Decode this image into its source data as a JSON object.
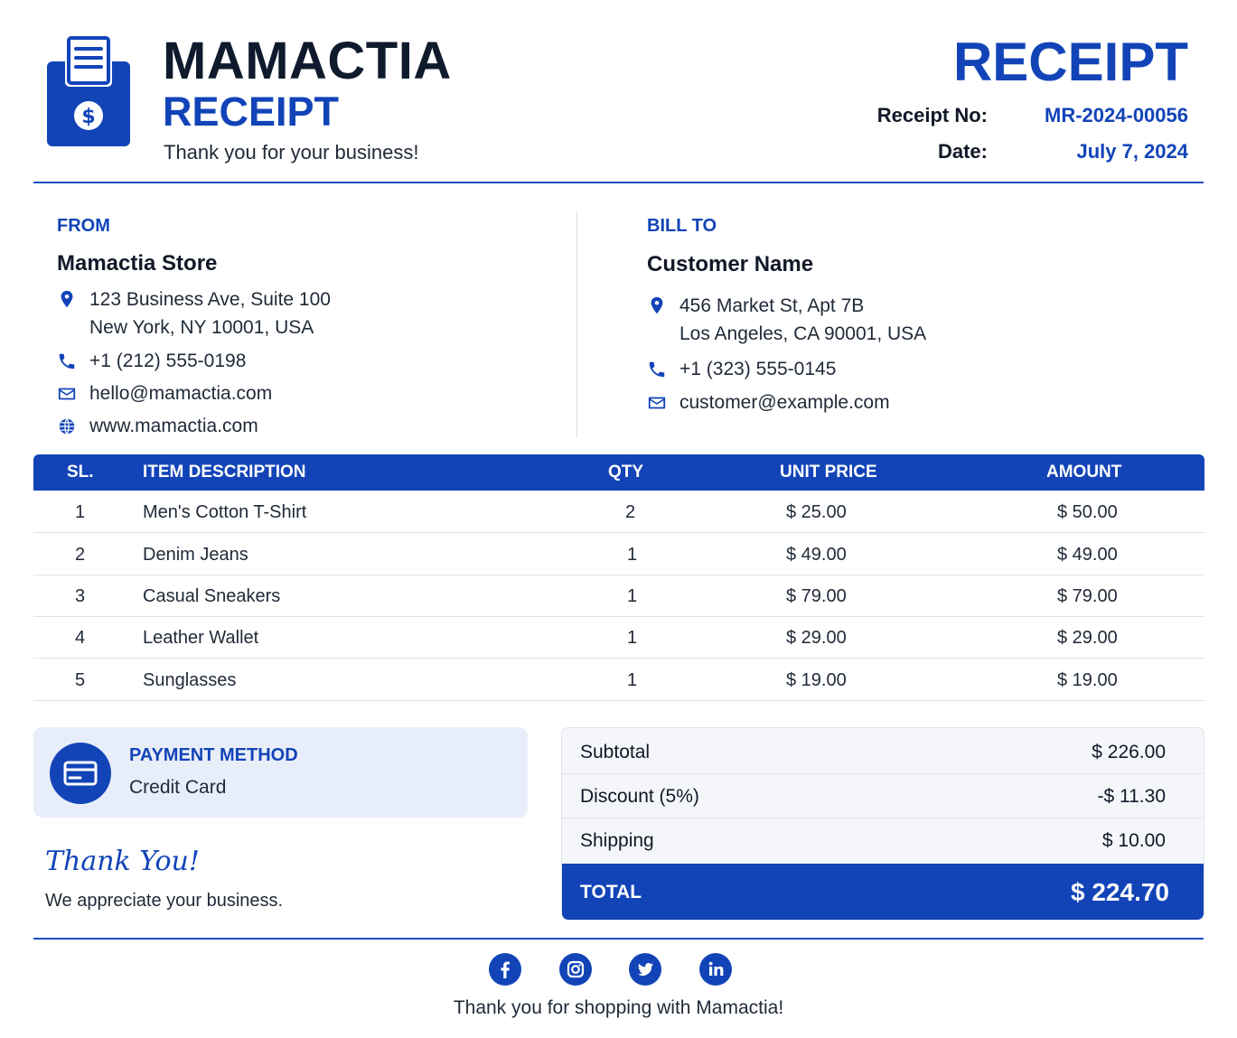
{
  "header": {
    "brand": "MAMACTIA",
    "subtitle": "RECEIPT",
    "tagline": "Thank you for your business!",
    "doc_title": "RECEIPT",
    "receipt_no_label": "Receipt No:",
    "receipt_no": "MR-2024-00056",
    "date_label": "Date:",
    "date": "July 7, 2024",
    "logo_icon": "receipt-dollar-icon"
  },
  "from": {
    "heading": "FROM",
    "name": "Mamactia Store",
    "address_line1": "123 Business Ave, Suite 100",
    "address_line2": "New York, NY 10001, USA",
    "phone": "+1 (212) 555-0198",
    "email": "hello@mamactia.com",
    "website": "www.mamactia.com"
  },
  "bill_to": {
    "heading": "BILL TO",
    "name": "Customer Name",
    "address_line1": "456 Market St, Apt 7B",
    "address_line2": "Los Angeles, CA 90001, USA",
    "phone": "+1 (323) 555-0145",
    "email": "customer@example.com"
  },
  "table": {
    "headers": [
      "SL.",
      "ITEM DESCRIPTION",
      "QTY",
      "UNIT PRICE",
      "AMOUNT"
    ],
    "rows": [
      {
        "sl": "1",
        "desc": "Men's Cotton T-Shirt",
        "qty": "2",
        "unit": "$ 25.00",
        "amount": "$ 50.00"
      },
      {
        "sl": "2",
        "desc": "Denim Jeans",
        "qty": "1",
        "unit": "$ 49.00",
        "amount": "$ 49.00"
      },
      {
        "sl": "3",
        "desc": "Casual Sneakers",
        "qty": "1",
        "unit": "$ 79.00",
        "amount": "$ 79.00"
      },
      {
        "sl": "4",
        "desc": "Leather Wallet",
        "qty": "1",
        "unit": "$ 29.00",
        "amount": "$ 29.00"
      },
      {
        "sl": "5",
        "desc": "Sunglasses",
        "qty": "1",
        "unit": "$ 19.00",
        "amount": "$ 19.00"
      }
    ]
  },
  "payment": {
    "heading": "PAYMENT METHOD",
    "method": "Credit Card"
  },
  "thanks": {
    "script": "Thank You!",
    "note": "We appreciate your business."
  },
  "totals": {
    "subtotal_label": "Subtotal",
    "subtotal": "$ 226.00",
    "discount_label": "Discount (5%)",
    "discount": "-$ 11.30",
    "shipping_label": "Shipping",
    "shipping": "$ 10.00",
    "total_label": "TOTAL",
    "total": "$ 224.70"
  },
  "footer": {
    "social_icons": [
      "facebook-icon",
      "instagram-icon",
      "twitter-icon",
      "linkedin-icon"
    ],
    "text": "Thank you for shopping with Mamactia!"
  },
  "colors": {
    "accent": "#1244b8",
    "dark": "#0f1b2d",
    "row_border": "#dfe3ea",
    "pay_bg": "#e8eef9"
  }
}
